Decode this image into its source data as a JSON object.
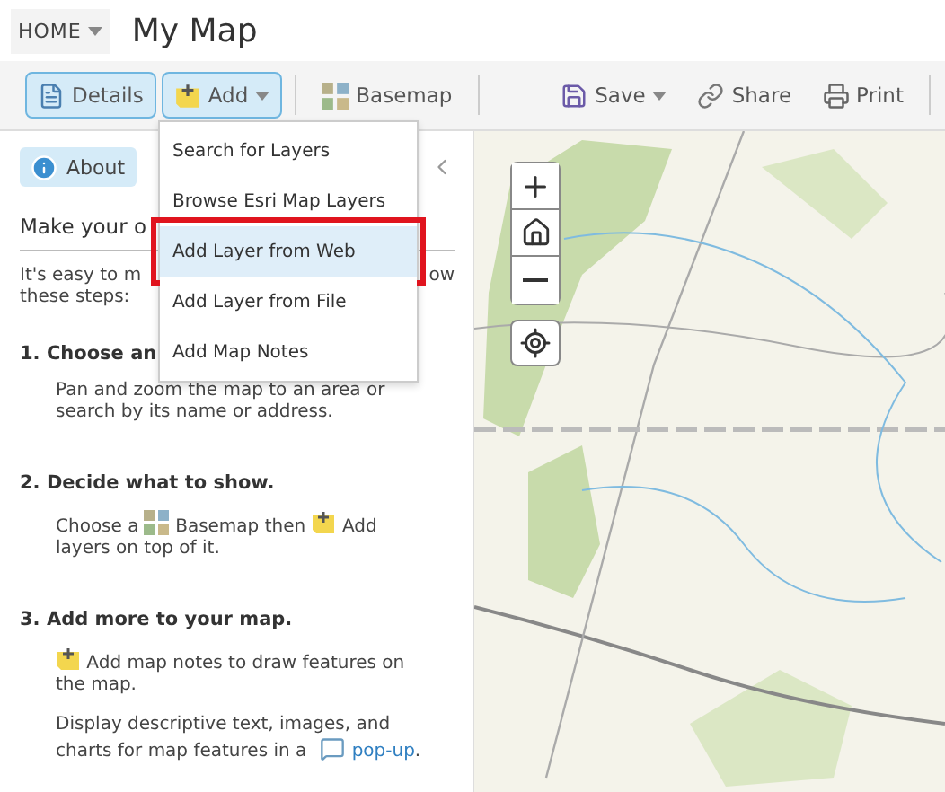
{
  "header": {
    "home": "HOME",
    "title": "My Map"
  },
  "toolbar": {
    "left": [
      {
        "kind": "details",
        "label": "Details",
        "selected": true,
        "dropdown": false
      },
      {
        "kind": "add",
        "label": "Add",
        "selected": true,
        "dropdown": true
      },
      {
        "kind": "basemap",
        "label": "Basemap",
        "selected": false,
        "dropdown": false
      }
    ],
    "right": [
      {
        "kind": "save",
        "label": "Save",
        "dropdown": true
      },
      {
        "kind": "share",
        "label": "Share",
        "dropdown": false
      },
      {
        "kind": "print",
        "label": "Print",
        "dropdown": false
      }
    ]
  },
  "add_menu": {
    "items": [
      {
        "label": "Search for Layers",
        "selected": false,
        "callout": false
      },
      {
        "label": "Browse Esri Map Layers",
        "selected": false,
        "callout": false
      },
      {
        "label": "Add Layer from Web",
        "selected": true,
        "callout": true
      },
      {
        "label": "Add Layer from File",
        "selected": false,
        "callout": false
      },
      {
        "label": "Add Map Notes",
        "selected": false,
        "callout": false
      }
    ]
  },
  "panel": {
    "tab": {
      "label": "About",
      "selected": true
    },
    "heading": "Make your o",
    "intro_left": "It's easy to m",
    "intro_right": "ow",
    "intro_line2": "these steps:",
    "steps": [
      {
        "title": "1. Choose an",
        "paragraphs": [
          [
            {
              "kind": "text",
              "text": "Pan and zoom the map to an area or search by its name or address."
            }
          ]
        ]
      },
      {
        "title": "2. Decide what to show.",
        "paragraphs": [
          [
            {
              "kind": "text",
              "text": "Choose a "
            },
            {
              "kind": "basemap-icon"
            },
            {
              "kind": "text",
              "text": " Basemap then "
            },
            {
              "kind": "add-icon"
            },
            {
              "kind": "text",
              "text": " Add layers on top of it."
            }
          ]
        ]
      },
      {
        "title": "3. Add more to your map.",
        "paragraphs": [
          [
            {
              "kind": "add-icon"
            },
            {
              "kind": "text",
              "text": " Add map notes to draw features on the map."
            }
          ],
          [
            {
              "kind": "text",
              "text": "Display descriptive text, images, and charts for map features in a "
            },
            {
              "kind": "popup-icon"
            },
            {
              "kind": "link",
              "text": "pop-up"
            },
            {
              "kind": "text",
              "text": "."
            }
          ]
        ]
      }
    ]
  },
  "map": {
    "controls": [
      {
        "kind": "zoom-in"
      },
      {
        "kind": "home"
      },
      {
        "kind": "zoom-out"
      }
    ],
    "locate": true
  }
}
